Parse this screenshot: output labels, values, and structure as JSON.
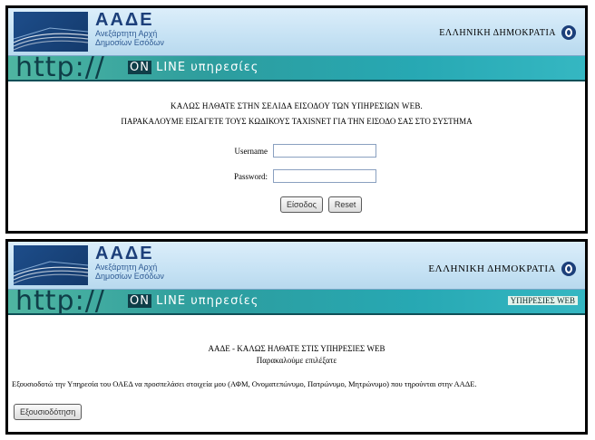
{
  "brand": {
    "name": "ΑΑΔΕ",
    "subtitle_line1": "Ανεξάρτητη Αρχή",
    "subtitle_line2": "Δημοσίων Εσόδων"
  },
  "republic": "ΕΛΛΗΝΙΚΗ ΔΗΜΟΚΡΑΤΙΑ",
  "band": {
    "http": "http://",
    "online_on": "ON",
    "online_rest": " LINE υπηρεσίες",
    "services_web": "ΥΠΗΡΕΣΙΕΣ WEB"
  },
  "login": {
    "welcome": "ΚΑΛΩΣ ΗΛΘΑΤΕ ΣΤΗΝ ΣΕΛΙΔΑ ΕΙΣΟΔΟΥ ΤΩΝ ΥΠΗΡΕΣΙΩΝ WEB.",
    "instruction": "ΠΑΡΑΚΑΛΟΥΜΕ ΕΙΣΑΓΕΤΕ ΤΟΥΣ ΚΩΔΙΚΟΥΣ TAXISNET ΓΙΑ ΤΗΝ ΕΙΣΟΔΟ ΣΑΣ ΣΤΟ ΣΥΣΤΗΜΑ",
    "username_label": "Username",
    "username_value": "",
    "password_label": "Password:",
    "password_value": "",
    "login_button": "Είσοδος",
    "reset_button": "Reset"
  },
  "services": {
    "title": "ΑΑΔΕ - ΚΑΛΩΣ ΗΛΘΑΤΕ ΣΤΙΣ ΥΠΗΡΕΣΙΕΣ WEB",
    "subtitle": "Παρακαλούμε επιλέξατε",
    "text": "Εξουσιοδοτώ την Υπηρεσία του ΟΑΕΔ να προσπελάσει στοιχεία μου (ΑΦΜ, Ονοματεπώνυμο, Πατρώνυμο, Μητρώνυμο) που τηρούνται στην ΑΑΔΕ.",
    "authorize_button": "Εξουσιοδότηση"
  }
}
